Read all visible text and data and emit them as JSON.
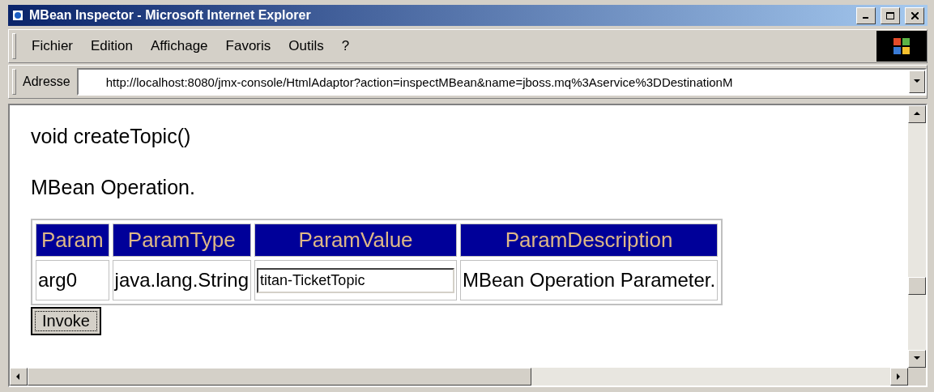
{
  "window": {
    "title": "MBean Inspector - Microsoft Internet Explorer"
  },
  "menu": [
    "Fichier",
    "Edition",
    "Affichage",
    "Favoris",
    "Outils",
    "?"
  ],
  "address_bar": {
    "label": "Adresse",
    "value": "http://localhost:8080/jmx-console/HtmlAdaptor?action=inspectMBean&name=jboss.mq%3Aservice%3DDestinationM"
  },
  "page": {
    "heading": "void createTopic()",
    "description": "MBean Operation.",
    "table": {
      "columns": [
        "Param",
        "ParamType",
        "ParamValue",
        "ParamDescription"
      ],
      "rows": [
        {
          "param": "arg0",
          "type": "java.lang.String",
          "value": "titan-TicketTopic",
          "description": "MBean Operation Parameter."
        }
      ]
    },
    "button": "Invoke"
  }
}
